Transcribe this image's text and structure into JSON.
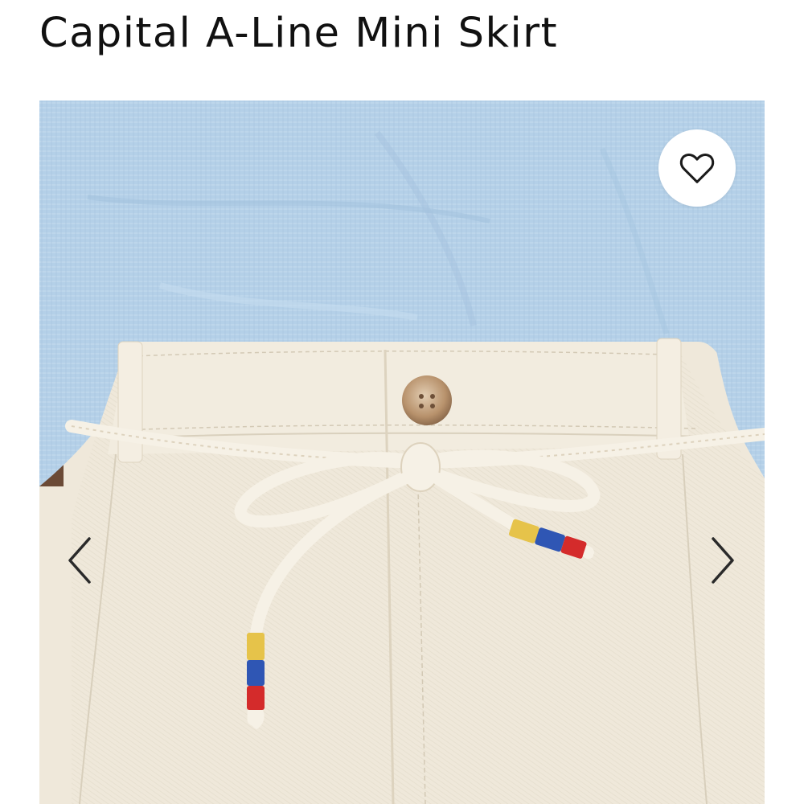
{
  "product": {
    "title": "Capital A-Line Mini Skirt"
  },
  "gallery": {
    "image_alt": "Cream denim skirt with rope belt tied at waist",
    "wishlist_icon": "heart-outline-icon",
    "prev_icon": "chevron-left-icon",
    "next_icon": "chevron-right-icon"
  },
  "colors": {
    "shirt": "#b4d0e8",
    "skirt": "#efe8da",
    "rope": "#f6f1e6",
    "button": "#c8a98a",
    "tip_yellow": "#e6c34a",
    "tip_blue": "#2f56b4",
    "tip_red": "#d42b2b",
    "icon": "#1a1a1a"
  }
}
